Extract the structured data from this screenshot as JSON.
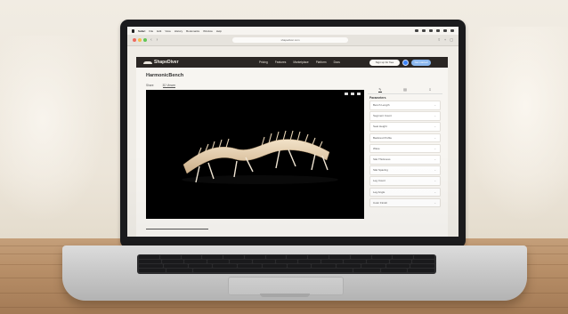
{
  "menubar": {
    "app": "Safari",
    "items": [
      "File",
      "Edit",
      "View",
      "History",
      "Bookmarks",
      "Window",
      "Help"
    ]
  },
  "browser": {
    "url": "shapediver.com"
  },
  "site": {
    "logo_text": "ShapeDiver",
    "nav": [
      "Pricing",
      "Features",
      "Marketplace",
      "Platform",
      "Docs"
    ],
    "signup_label": "Sign up for free",
    "getstarted_label": "Get started"
  },
  "model": {
    "title": "HarmonicBench",
    "tabs": [
      "Share",
      "3D Viewer"
    ],
    "parameters_title": "Parameters",
    "parameters": [
      "Bench Length",
      "Segment Count",
      "Seat Height",
      "Backrest Profile",
      "Wave",
      "Slat Thickness",
      "Slat Spacing",
      "Leg Count",
      "Leg Angle",
      "Color Finish"
    ]
  },
  "colors": {
    "site_header": "#2a2624",
    "accent_blue": "#3b82f6",
    "viewer_bg": "#000000",
    "wood": "#e9d7bd"
  }
}
